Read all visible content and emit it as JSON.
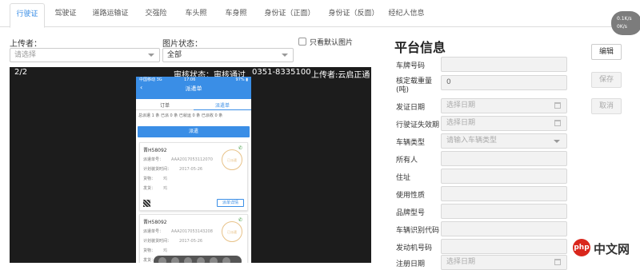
{
  "tabs": [
    "行驶证",
    "驾驶证",
    "道路运输证",
    "交强险",
    "车头照",
    "车身照",
    "身份证（正面）",
    "身份证（反面）",
    "经纪人信息"
  ],
  "speed": {
    "up": "0.1K/s",
    "down": "0K/s"
  },
  "filters": {
    "uploader_label": "上传者：",
    "uploader_placeholder": "请选择",
    "status_label": "图片状态：",
    "status_value": "全部",
    "only_default_label": "只看默认图片"
  },
  "viewer": {
    "counter": "2/2",
    "review_status": "审核状态：审核通过",
    "phone": "0351-8335100",
    "uploader": "上传者:云启正通"
  },
  "phone": {
    "status_left": "中国移动 3G",
    "status_right": "97% ▮",
    "time": "17:06",
    "title": "派遣单",
    "back": "‹",
    "tabs": [
      "订单",
      "派遣单"
    ],
    "stats": "总派遣 1 条    已派 0 条    已就运 0 条    已派收 0 条",
    "dispatch_btn": "派遣",
    "cards": [
      {
        "plate": "晋H58092",
        "rows": [
          [
            "派遣单号：",
            "AAA2017053112070"
          ],
          [
            "计划装货时间：",
            "2017-05-26"
          ],
          [
            "货物：",
            "鸡"
          ],
          [
            "发货：",
            "鸡"
          ]
        ],
        "stamp": "已派遣",
        "action": "派单详情"
      },
      {
        "plate": "晋H58092",
        "rows": [
          [
            "派遣单号：",
            "AAA2017053143208"
          ],
          [
            "计划装货时间：",
            "2017-05-26"
          ],
          [
            "货物：",
            "鸡"
          ],
          [
            "发货：",
            "鸡"
          ]
        ],
        "stamp": "已派遣"
      }
    ]
  },
  "platform": {
    "title": "平台信息",
    "fields": [
      {
        "label": "车牌号码",
        "value": ""
      },
      {
        "label": "核定载重量(吨)",
        "value": "0"
      },
      {
        "label": "发证日期",
        "placeholder": "选择日期"
      },
      {
        "label": "行驶证失效期",
        "placeholder": "选择日期"
      },
      {
        "label": "车辆类型",
        "placeholder": "请输入车辆类型"
      },
      {
        "label": "所有人",
        "value": ""
      },
      {
        "label": "住址",
        "value": ""
      },
      {
        "label": "使用性质",
        "value": ""
      },
      {
        "label": "品牌型号",
        "value": ""
      },
      {
        "label": "车辆识别代码",
        "value": ""
      },
      {
        "label": "发动机号码",
        "value": ""
      },
      {
        "label": "注册日期",
        "placeholder": "选择日期"
      }
    ],
    "buttons": {
      "edit": "编辑",
      "save": "保存",
      "cancel": "取消"
    }
  },
  "watermark": {
    "badge": "php",
    "text": "中文网"
  }
}
